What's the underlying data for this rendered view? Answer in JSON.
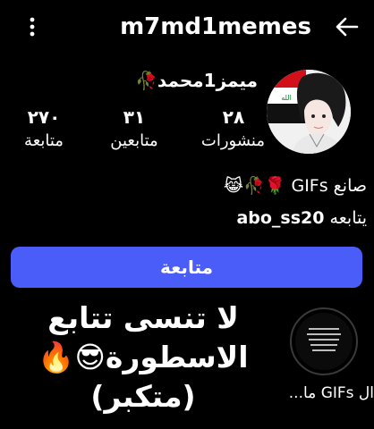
{
  "header": {
    "username": "m7md1memes",
    "back_icon": "arrow-left-icon",
    "menu_icon": "more-vertical-icon"
  },
  "profile": {
    "display_name": "ميمز1محمد🥀",
    "avatar_icon": "avatar-image",
    "stats": [
      {
        "value": "٢٨",
        "label": "منشورات"
      },
      {
        "value": "٣١",
        "label": "متابعين"
      },
      {
        "value": "٢٧٠",
        "label": "متابعة"
      }
    ],
    "bio": "صانع GIFs 🌹🥀😹",
    "followed_by_prefix": "يتابعه",
    "followed_by_user": "abo_ss20"
  },
  "follow_button_label": "متابعة",
  "highlights": [
    {
      "label": "ال GIFs ما..."
    }
  ],
  "overlay_caption": {
    "line1": "لا تنسى تتابع",
    "line2": "الاسطورة😎🔥",
    "line3": "(متكبر)"
  },
  "colors": {
    "background": "#000000",
    "primary_button": "#4a5df9",
    "text": "#ffffff"
  }
}
